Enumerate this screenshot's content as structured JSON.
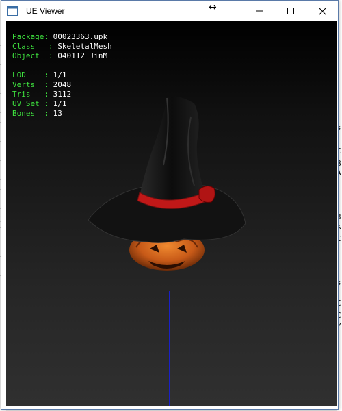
{
  "window": {
    "title": "UE Viewer",
    "cursor_glyph": "↔"
  },
  "info": {
    "package_label": "Package",
    "package_value": "00023363.upk",
    "class_label": "Class",
    "class_value": "SkeletalMesh",
    "object_label": "Object",
    "object_value": "040112_JinM",
    "lod_label": "LOD",
    "lod_value": "1/1",
    "verts_label": "Verts",
    "verts_value": "2048",
    "tris_label": "Tris",
    "tris_value": "3112",
    "uvset_label": "UV Set",
    "uvset_value": "1/1",
    "bones_label": "Bones",
    "bones_value": "13"
  },
  "background_console": {
    "left_chars": [
      "t",
      "c",
      "t",
      "b",
      "t",
      "t",
      "t",
      "t",
      "t",
      "t",
      "t",
      "c",
      "t",
      "c",
      "t",
      "t",
      "t",
      "t",
      "3",
      "t",
      "c",
      "t",
      "t",
      "t",
      "t"
    ],
    "right_chars": [
      "s",
      "C",
      "B",
      "A",
      "3",
      "k",
      "C",
      "C",
      "s",
      "C",
      "Y"
    ]
  },
  "colors": {
    "label_green": "#3ee03e",
    "value_white": "#ffffff",
    "axis_blue": "#1a20c8",
    "hat_black": "#151515",
    "band_red": "#c01818",
    "pumpkin_orange": "#d0601a"
  }
}
